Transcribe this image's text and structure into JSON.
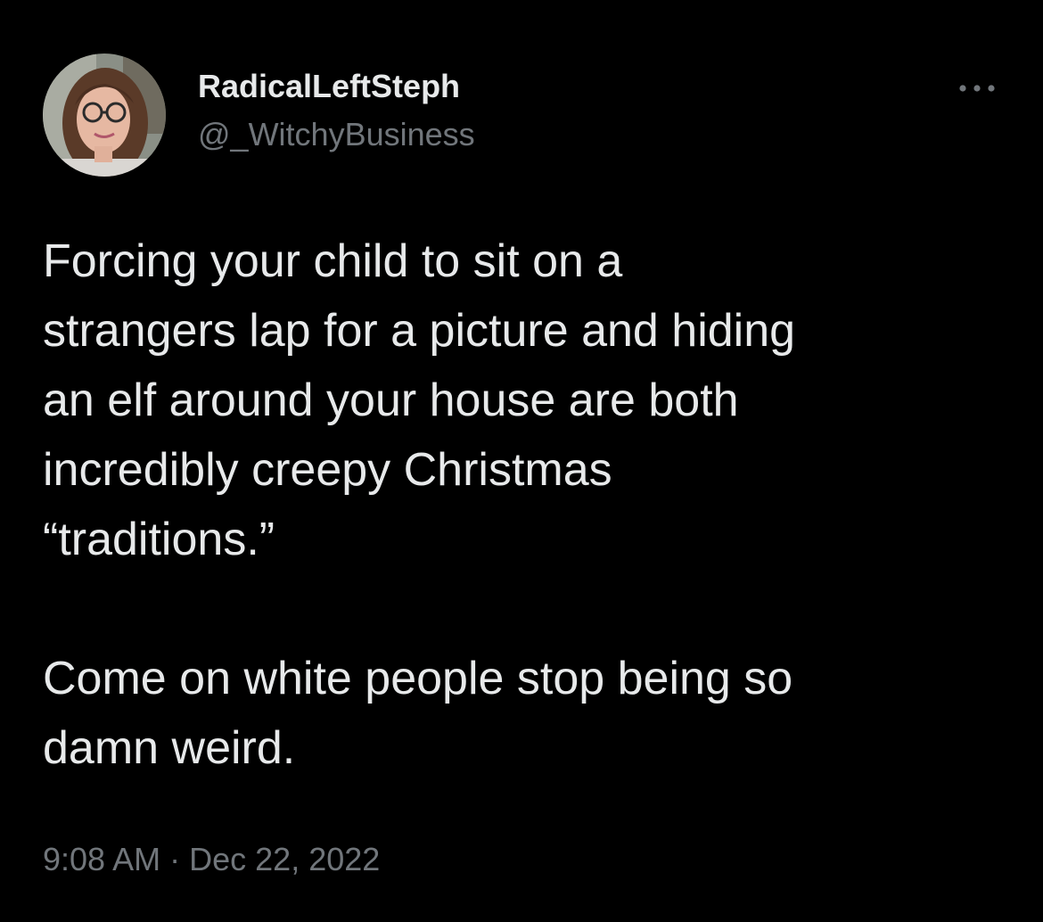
{
  "tweet": {
    "author": {
      "display_name": "RadicalLeftSteph",
      "handle": "@_WitchyBusiness",
      "avatar_icon": "profile-photo"
    },
    "more_icon": "ellipsis-icon",
    "text": "Forcing your child to sit on a\nstrangers lap for a picture and hiding\nan elf around your house are both\nincredibly creepy Christmas\n“traditions.”\n\nCome on white people stop being so\ndamn weird.",
    "time": "9:08 AM",
    "separator": "·",
    "date": "Dec 22, 2022"
  },
  "colors": {
    "background": "#000000",
    "primary_text": "#e7e9ea",
    "secondary_text": "#71767b"
  }
}
